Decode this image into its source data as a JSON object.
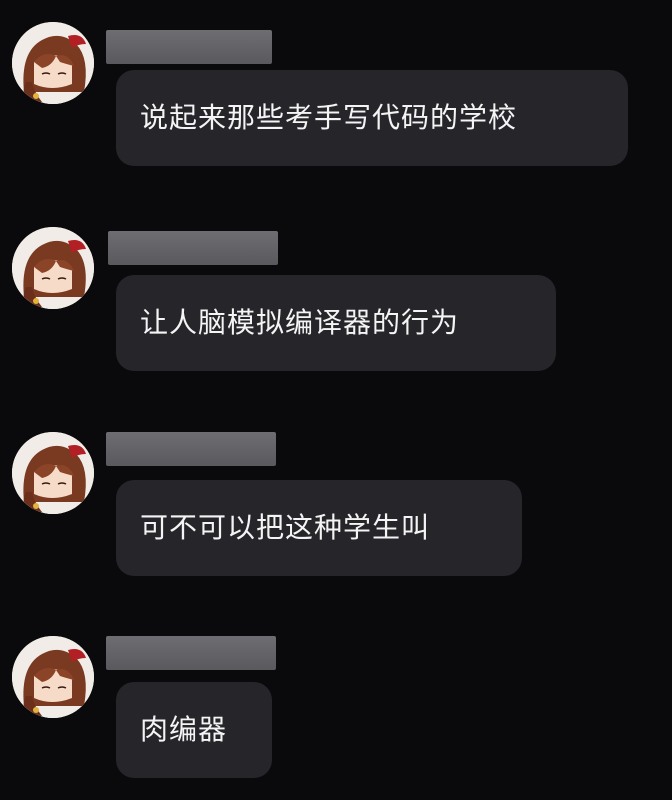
{
  "messages": [
    {
      "sender_name": "",
      "text": "说起来那些考手写代码的学校",
      "avatar": "anime-girl-avatar"
    },
    {
      "sender_name": "",
      "text": "让人脑模拟编译器的行为",
      "avatar": "anime-girl-avatar"
    },
    {
      "sender_name": "",
      "text": "可不可以把这种学生叫",
      "avatar": "anime-girl-avatar"
    },
    {
      "sender_name": "",
      "text": "肉编器",
      "avatar": "anime-girl-avatar"
    }
  ],
  "colors": {
    "background": "#0a090b",
    "bubble": "#26252a",
    "bubble_text": "#f4f4f4",
    "redacted_name": "#666569"
  }
}
